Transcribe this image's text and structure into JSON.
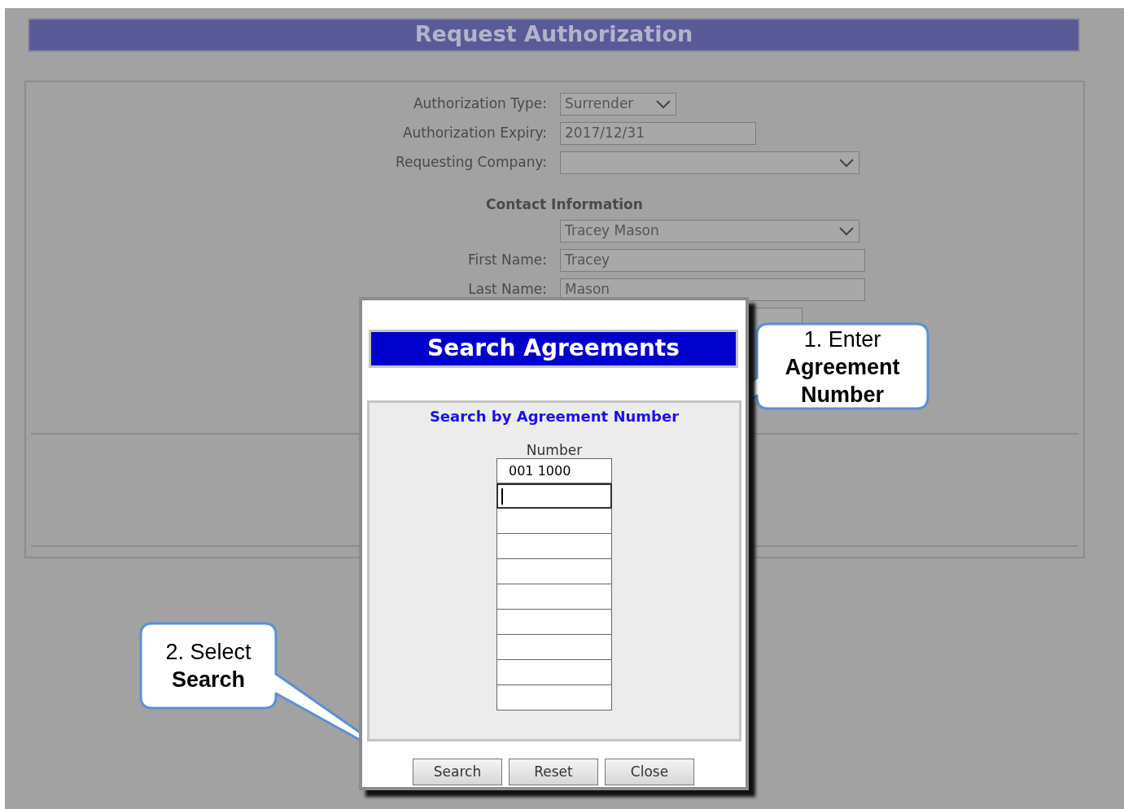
{
  "header": {
    "title": "Request Authorization"
  },
  "form": {
    "fields": [
      {
        "kind": "select",
        "label": "Authorization Type:",
        "value": "Surrender"
      },
      {
        "kind": "input",
        "label": "Authorization Expiry:",
        "value": "2017/12/31"
      },
      {
        "kind": "select",
        "label": "Requesting Company:"
      }
    ],
    "contact_section": {
      "heading": "Contact Information",
      "fields": [
        {
          "kind": "select",
          "value": "Tracey Mason"
        },
        {
          "kind": "input",
          "label": "First Name:",
          "value": "Tracey"
        },
        {
          "kind": "input",
          "label": "Last Name:",
          "value": "Mason"
        },
        {
          "kind": "input"
        }
      ]
    }
  },
  "dialog": {
    "title": "Search Agreements",
    "group_title": "Search by Agreement Number",
    "column_label": "Number",
    "number_fields": [
      {
        "value": "001 1000",
        "focused": false
      },
      {
        "focused": true
      },
      {
        "focused": false
      },
      {
        "focused": false
      },
      {
        "focused": false
      },
      {
        "focused": false
      },
      {
        "focused": false
      },
      {
        "focused": false
      },
      {
        "focused": false
      },
      {
        "focused": false
      }
    ],
    "buttons": [
      "Search",
      "Reset",
      "Close"
    ]
  },
  "callouts": [
    {
      "text": "1. Enter **Agreement Number**"
    },
    {
      "text": "2. Select **Search**"
    }
  ]
}
